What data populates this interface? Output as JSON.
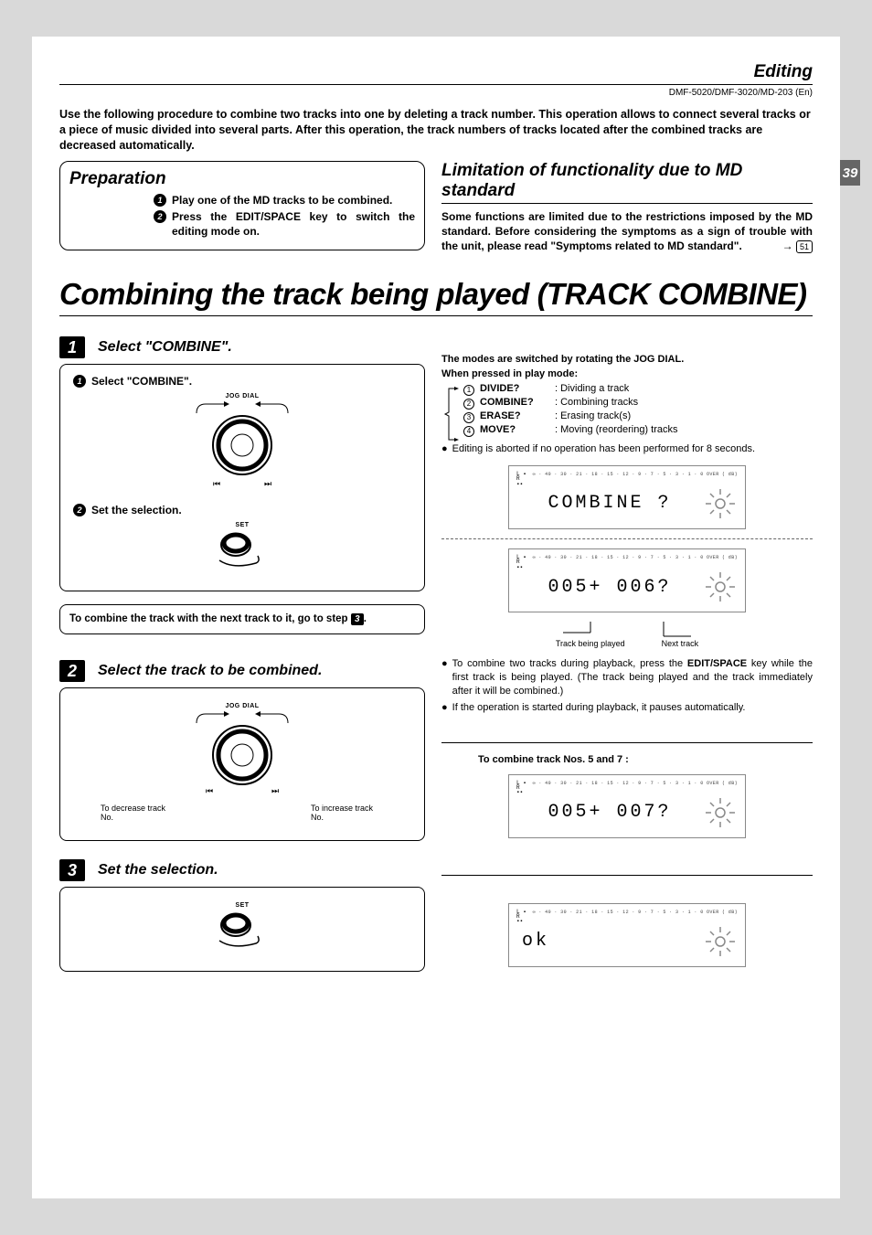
{
  "header": {
    "section": "Editing",
    "models": "DMF-5020/DMF-3020/MD-203 (En)",
    "pageNumber": "39"
  },
  "intro": "Use the following procedure to combine two tracks into one by deleting a track number. This operation allows to connect several tracks or a piece of music divided into several parts. After this operation, the track numbers of tracks located after the combined tracks are decreased automatically.",
  "prep": {
    "title": "Preparation",
    "items": [
      "Play one of the MD tracks to be combined.",
      "Press the EDIT/SPACE key to switch the editing mode on."
    ]
  },
  "limit": {
    "title": "Limitation of functionality due to MD standard",
    "body": "Some functions are limited due to the restrictions imposed by the MD standard. Before considering the symptoms as a sign of trouble with the unit, please read \"Symptoms related to MD standard\".",
    "ref": "51"
  },
  "mainTitle": "Combining the track being played (TRACK  COMBINE)",
  "steps": {
    "s1": {
      "title": "Select \"COMBINE\".",
      "sub1": "Select \"COMBINE\".",
      "jogLabel": "JOG DIAL",
      "sub2": "Set the selection.",
      "setLabel": "SET",
      "note": "To combine the track with the next track to it, go to step"
    },
    "s2": {
      "title": "Select the track to be combined.",
      "jogLabel": "JOG DIAL",
      "decrease": "To decrease track No.",
      "increase": "To increase track No."
    },
    "s3": {
      "title": "Set the selection.",
      "setLabel": "SET"
    }
  },
  "right": {
    "modeIntro1": "The modes are switched by rotating the JOG DIAL.",
    "modeIntro2": "When pressed in play mode:",
    "modes": [
      {
        "n": "1",
        "name": "DIVIDE?",
        "desc": ": Dividing a track"
      },
      {
        "n": "2",
        "name": "COMBINE?",
        "desc": ": Combining tracks"
      },
      {
        "n": "3",
        "name": "ERASE?",
        "desc": ": Erasing track(s)"
      },
      {
        "n": "4",
        "name": "MOVE?",
        "desc": ": Moving (reordering) tracks"
      }
    ],
    "abort": "Editing is aborted if no operation has been performed for 8 seconds.",
    "lcd1": "COMBINE ?",
    "lcd2": "005+ 006?",
    "trackPlayed": "Track being played",
    "nextTrack": "Next track",
    "para1": "To combine two tracks during playback, press the ",
    "para1b": "EDIT/SPACE",
    "para1c": " key while the first track is being played. (The track being played and the track immediately after it will be combined.)",
    "para2": "If the operation is started during playback, it pauses automatically.",
    "combEx": "To combine track Nos. 5 and 7 :",
    "lcd3": "005+ 007?",
    "lcd4": "ok",
    "scale": "∞ · 40 · 30 · 21 · 18 · 15 · 12 · 9 · 7 · 5 · 3 · 1 · 0  OVER ( dB)"
  }
}
